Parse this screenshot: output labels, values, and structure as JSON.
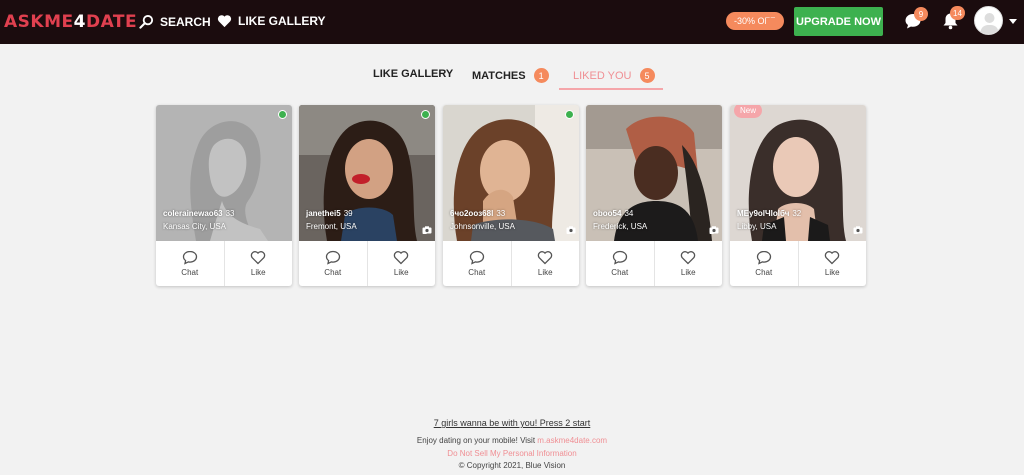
{
  "header": {
    "logo_part1": "ASKME",
    "logo_part2": "4",
    "logo_part3": "DATE",
    "search_label": "SEARCH",
    "like_gallery_label": "LIKE GALLERY",
    "discount_label": "-30% OFF",
    "upgrade_label": "UPGRADE NOW",
    "messages_count": "9",
    "notifications_count": "14"
  },
  "tabs": [
    {
      "label": "LIKE GALLERY",
      "count": ""
    },
    {
      "label": "MATCHES",
      "count": "1"
    },
    {
      "label": "LIKED YOU",
      "count": "5"
    }
  ],
  "cards": [
    {
      "name": "colerainewao63",
      "age": "33",
      "location": "Kansas City, USA",
      "photos": "",
      "online": true,
      "new": false
    },
    {
      "name": "janethei5",
      "age": "39",
      "location": "Fremont, USA",
      "photos": "1",
      "online": true,
      "new": false
    },
    {
      "name": "6чо2оoз68l",
      "age": "33",
      "location": "Johnsonville, USA",
      "photos": "1",
      "online": true,
      "new": false
    },
    {
      "name": "oboo54",
      "age": "34",
      "location": "Frederick, USA",
      "photos": "1",
      "online": false,
      "new": false
    },
    {
      "name": "MEy9olЧlolбч",
      "age": "32",
      "location": "Libby, USA",
      "photos": "1",
      "online": false,
      "new": true
    }
  ],
  "card_actions": {
    "chat_label": "Chat",
    "like_label": "Like"
  },
  "new_badge": "New",
  "footer": {
    "promo": "7 girls wanna be with you! Press 2 start",
    "mobile_text": "Enjoy dating on your mobile! Visit ",
    "mobile_link": "m.askme4date.com",
    "privacy": "Do Not Sell My Personal Information",
    "copyright": "© Copyright 2021, Blue Vision"
  },
  "colors": {
    "accent": "#f58a5d",
    "upgrade": "#3db14f",
    "header_bg": "#1b0c0e",
    "pink": "#f08f94"
  }
}
